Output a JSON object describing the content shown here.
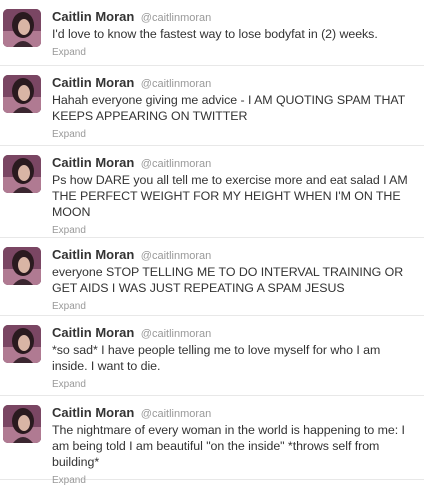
{
  "tweets": [
    {
      "author": "Caitlin Moran",
      "handle": "@caitlinmoran",
      "text": "I'd love to know the fastest way to lose bodyfat in (2) weeks.",
      "expand": "Expand"
    },
    {
      "author": "Caitlin Moran",
      "handle": "@caitlinmoran",
      "text": "Hahah everyone giving me advice - I AM QUOTING SPAM THAT KEEPS APPEARING ON TWITTER",
      "expand": "Expand"
    },
    {
      "author": "Caitlin Moran",
      "handle": "@caitlinmoran",
      "text": "Ps how DARE you all tell me to exercise more and eat salad I AM THE PERFECT WEIGHT FOR MY HEIGHT WHEN I'M ON THE MOON",
      "expand": "Expand"
    },
    {
      "author": "Caitlin Moran",
      "handle": "@caitlinmoran",
      "text": "everyone STOP TELLING ME TO DO INTERVAL TRAINING OR GET AIDS I WAS JUST REPEATING A SPAM JESUS",
      "expand": "Expand"
    },
    {
      "author": "Caitlin Moran",
      "handle": "@caitlinmoran",
      "text": "*so sad* I have people telling me to love myself for who I am inside. I want to die.",
      "expand": "Expand"
    },
    {
      "author": "Caitlin Moran",
      "handle": "@caitlinmoran",
      "text": "The nightmare of every woman in the world is happening to me: I am being told I am beautiful \"on the inside\" *throws self from building*",
      "expand": "Expand"
    }
  ]
}
